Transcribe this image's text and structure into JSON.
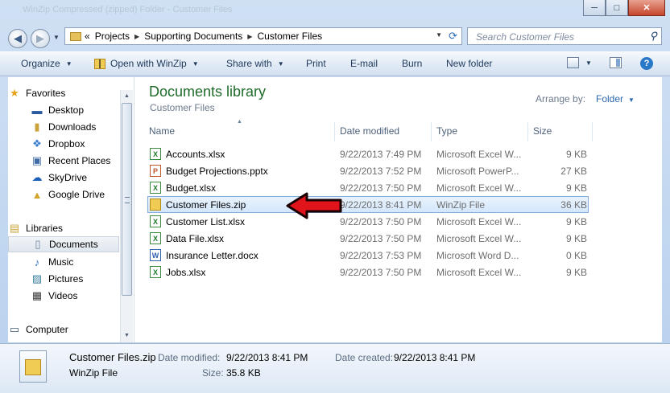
{
  "window": {
    "title": "WinZip Compressed (zipped) Folder - Customer Files",
    "minimize_glyph": "─",
    "maximize_glyph": "□",
    "close_glyph": "✕"
  },
  "address": {
    "overflow_glyph": "«",
    "segments": [
      "Projects",
      "Supporting Documents",
      "Customer Files"
    ],
    "search_placeholder": "Search Customer Files"
  },
  "toolbar": {
    "organize": "Organize",
    "open_with": "Open with WinZip",
    "share_with": "Share with",
    "print": "Print",
    "email": "E-mail",
    "burn": "Burn",
    "new_folder": "New folder",
    "help_glyph": "?"
  },
  "nav": {
    "favorites_label": "Favorites",
    "favorites": [
      "Desktop",
      "Downloads",
      "Dropbox",
      "Recent Places",
      "SkyDrive",
      "Google Drive"
    ],
    "libraries_label": "Libraries",
    "libraries": [
      "Documents",
      "Music",
      "Pictures",
      "Videos"
    ],
    "computer_label": "Computer"
  },
  "library": {
    "title": "Documents library",
    "subtitle": "Customer Files",
    "arrange_label": "Arrange by:",
    "arrange_value": "Folder"
  },
  "columns": {
    "name": "Name",
    "date": "Date modified",
    "type": "Type",
    "size": "Size"
  },
  "files": [
    {
      "name": "Accounts.xlsx",
      "date": "9/22/2013 7:49 PM",
      "type": "Microsoft Excel W...",
      "size": "9 KB",
      "icon": "excel-icon"
    },
    {
      "name": "Budget Projections.pptx",
      "date": "9/22/2013 7:52 PM",
      "type": "Microsoft PowerP...",
      "size": "27 KB",
      "icon": "powerpoint-icon"
    },
    {
      "name": "Budget.xlsx",
      "date": "9/22/2013 7:50 PM",
      "type": "Microsoft Excel W...",
      "size": "9 KB",
      "icon": "excel-icon"
    },
    {
      "name": "Customer Files.zip",
      "date": "9/22/2013 8:41 PM",
      "type": "WinZip File",
      "size": "36 KB",
      "icon": "zip-icon"
    },
    {
      "name": "Customer List.xlsx",
      "date": "9/22/2013 7:50 PM",
      "type": "Microsoft Excel W...",
      "size": "9 KB",
      "icon": "excel-icon"
    },
    {
      "name": "Data File.xlsx",
      "date": "9/22/2013 7:50 PM",
      "type": "Microsoft Excel W...",
      "size": "9 KB",
      "icon": "excel-icon"
    },
    {
      "name": "Insurance Letter.docx",
      "date": "9/22/2013 7:53 PM",
      "type": "Microsoft Word D...",
      "size": "0 KB",
      "icon": "word-icon"
    },
    {
      "name": "Jobs.xlsx",
      "date": "9/22/2013 7:50 PM",
      "type": "Microsoft Excel W...",
      "size": "9 KB",
      "icon": "excel-icon"
    }
  ],
  "selected_index": 3,
  "details": {
    "name": "Customer Files.zip",
    "type": "WinZip File",
    "date_modified_label": "Date modified:",
    "date_modified": "9/22/2013 8:41 PM",
    "date_created_label": "Date created:",
    "date_created": "9/22/2013 8:41 PM",
    "size_label": "Size:",
    "size": "35.8 KB"
  },
  "colors": {
    "library_title": "#1e6b2a",
    "pointer_arrow": "#e0141a",
    "selection_border": "#84acdd"
  }
}
